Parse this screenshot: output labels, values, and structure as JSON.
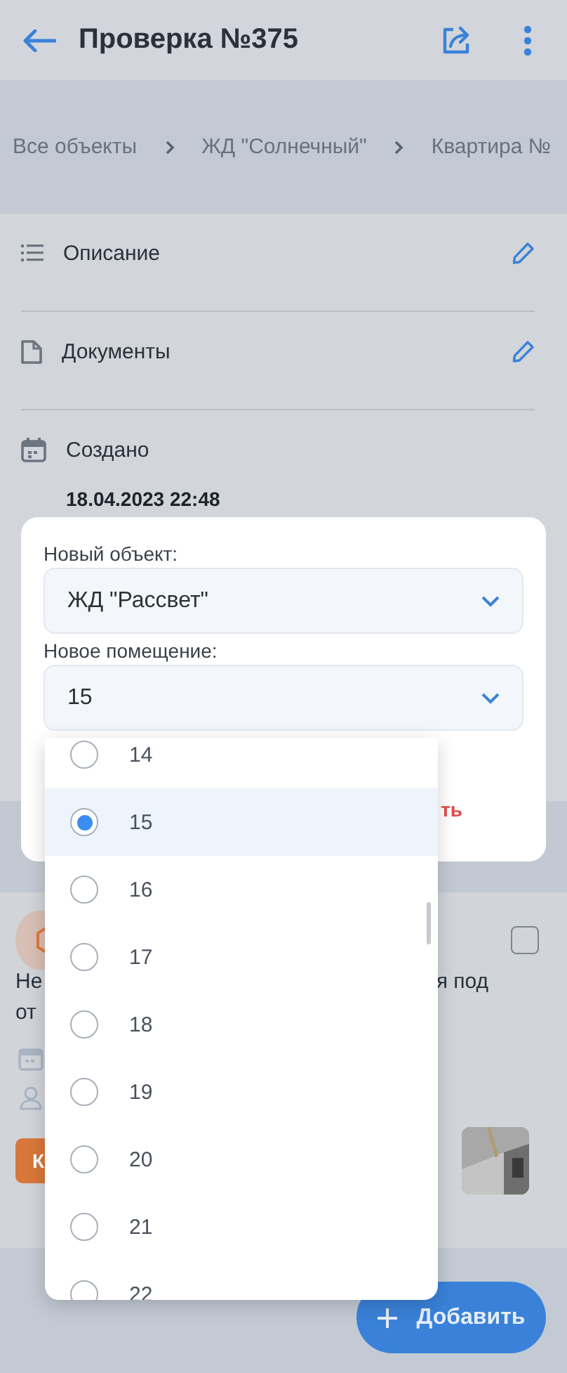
{
  "header": {
    "title": "Проверка №375"
  },
  "breadcrumbs": [
    "Все объекты",
    "ЖД \"Солнечный\"",
    "Квартира №"
  ],
  "sections": [
    {
      "kind": "list",
      "label": "Описание",
      "editable": true
    },
    {
      "kind": "document",
      "label": "Документы",
      "editable": true
    },
    {
      "kind": "calendar",
      "label": "Создано",
      "value": "18.04.2023 22:48",
      "editable": false
    }
  ],
  "card": {
    "text_left": [
      "Не",
      "от"
    ],
    "text_right": "я под",
    "checked": false,
    "button_label": "К"
  },
  "modal": {
    "fields": [
      {
        "label": "Новый объект:",
        "value": "ЖД \"Рассвет\""
      },
      {
        "label": "Новое помещение:",
        "value": "15"
      }
    ],
    "danger_text": "ть"
  },
  "dropdown": {
    "options": [
      {
        "label": "14",
        "selected": false
      },
      {
        "label": "15",
        "selected": true
      },
      {
        "label": "16",
        "selected": false
      },
      {
        "label": "17",
        "selected": false
      },
      {
        "label": "18",
        "selected": false
      },
      {
        "label": "19",
        "selected": false
      },
      {
        "label": "20",
        "selected": false
      },
      {
        "label": "21",
        "selected": false
      },
      {
        "label": "22",
        "selected": false
      }
    ]
  },
  "fab": {
    "label": "Добавить"
  }
}
